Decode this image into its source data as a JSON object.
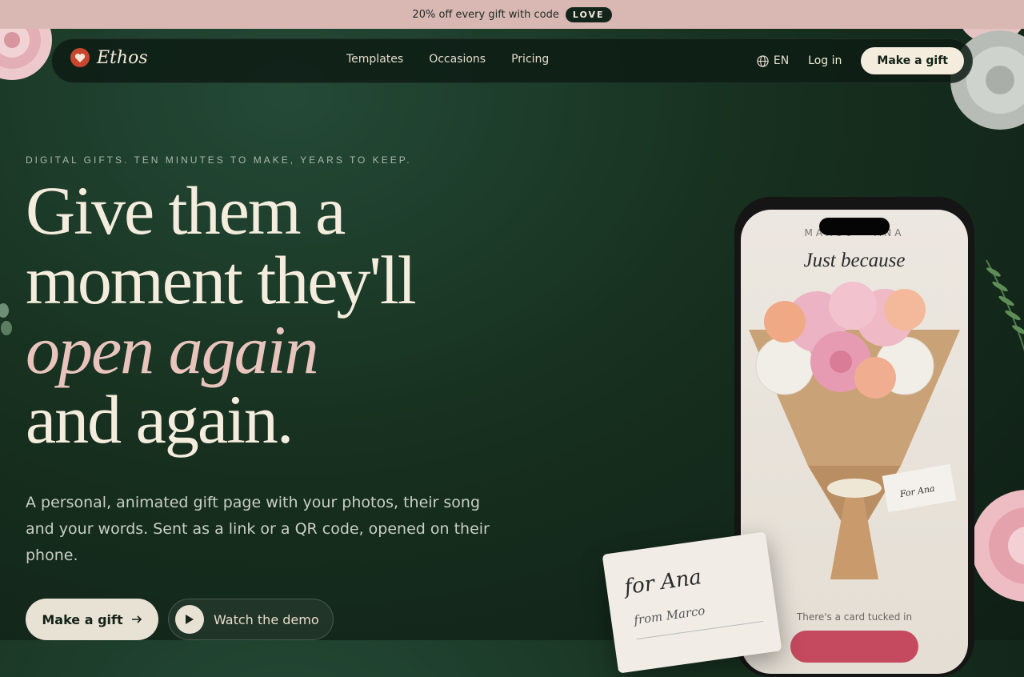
{
  "promo_bar": {
    "text": "20% off every gift with code",
    "code": "LOVE"
  },
  "nav": {
    "brand": "Ethos",
    "links": [
      "Templates",
      "Occasions",
      "Pricing"
    ],
    "language": "EN",
    "login": "Log in",
    "cta": "Make a gift"
  },
  "hero": {
    "eyebrow": "DIGITAL GIFTS. TEN MINUTES TO MAKE, YEARS TO KEEP.",
    "headline": {
      "line1": "Give them a",
      "line2": "moment they'll",
      "line3_accent": "open again",
      "line4": "and again."
    },
    "subtitle": "A personal, animated gift page with your photos, their song and your words. Sent as a link or a QR code, opened on their phone.",
    "primary_cta": "Make a gift",
    "secondary_cta": "Watch the demo"
  },
  "phone_preview": {
    "names": "MARCO · ANA",
    "title": "Just because",
    "tag_text": "For Ana",
    "card_hint": "There's a card tucked in"
  },
  "note_card": {
    "to": "for Ana",
    "from": "from Marco"
  },
  "colors": {
    "background": "#17301f",
    "promo_bar": "#d9b8b4",
    "cream": "#f4ecdc",
    "accent_pink": "#e8c4bd",
    "phone_button": "#c64a5f"
  }
}
